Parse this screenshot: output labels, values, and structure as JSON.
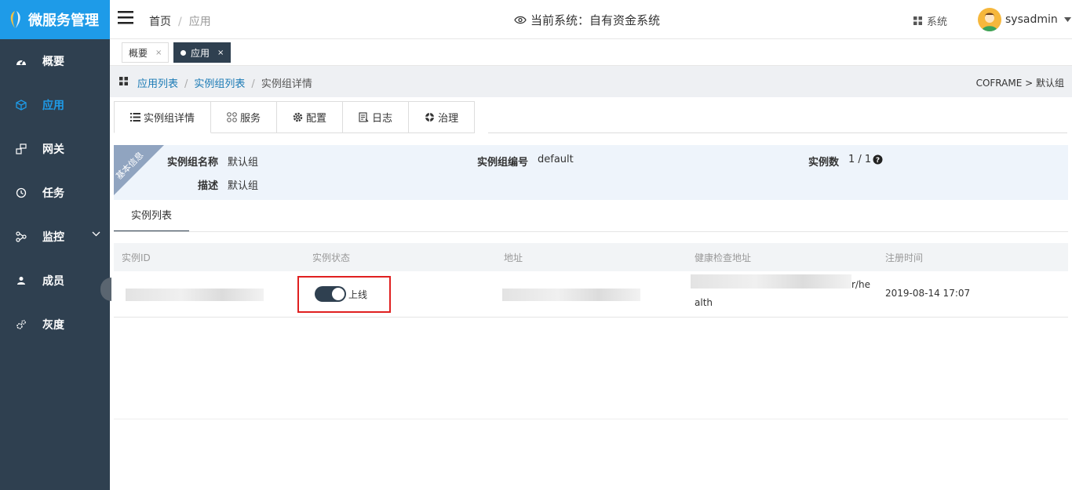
{
  "logo": {
    "text": "微服务管理"
  },
  "sidebar": {
    "items": [
      {
        "label": "概要",
        "icon": "dashboard-icon"
      },
      {
        "label": "应用",
        "icon": "cube-icon",
        "active": true
      },
      {
        "label": "网关",
        "icon": "gateway-icon"
      },
      {
        "label": "任务",
        "icon": "clock-icon"
      },
      {
        "label": "监控",
        "icon": "monitor-icon",
        "expandable": true
      },
      {
        "label": "成员",
        "icon": "user-icon"
      },
      {
        "label": "灰度",
        "icon": "gears-icon"
      }
    ]
  },
  "topbar": {
    "breadcrumb": {
      "home": "首页",
      "current": "应用"
    },
    "system_title": "当前系统：自有资金系统",
    "system_button": "系统",
    "username": "sysadmin"
  },
  "page_tabs": [
    {
      "label": "概要",
      "close": "×"
    },
    {
      "label": "应用",
      "close": "×",
      "active": true
    }
  ],
  "breadcrumb2": {
    "items": [
      "应用列表",
      "实例组列表"
    ],
    "current": "实例组详情",
    "right": "COFRAME > 默认组"
  },
  "content_tabs": [
    {
      "label": "实例组详情",
      "icon": "list-icon"
    },
    {
      "label": "服务",
      "icon": "grid-circles-icon"
    },
    {
      "label": "配置",
      "icon": "gear-icon"
    },
    {
      "label": "日志",
      "icon": "log-icon"
    },
    {
      "label": "治理",
      "icon": "lifebuoy-icon"
    }
  ],
  "basic_info": {
    "ribbon": "基本信息",
    "group_name_label": "实例组名称",
    "group_name": "默认组",
    "group_code_label": "实例组编号",
    "group_code": "default",
    "instance_count_label": "实例数",
    "instance_count": "1 / 1",
    "desc_label": "描述",
    "desc": "默认组"
  },
  "sub_tab": "实例列表",
  "table": {
    "headers": [
      "实例ID",
      "实例状态",
      "地址",
      "健康检查地址",
      "注册时间"
    ],
    "rows": [
      {
        "status": "上线",
        "status_on": true,
        "health_suffix": "r/he",
        "health_suffix2": "alth",
        "registered": "2019-08-14 17:07"
      }
    ]
  },
  "colors": {
    "sidebar": "#2f4050",
    "logo": "#1e9be8",
    "accent": "#1e9be8",
    "highlight": "#e02020"
  }
}
